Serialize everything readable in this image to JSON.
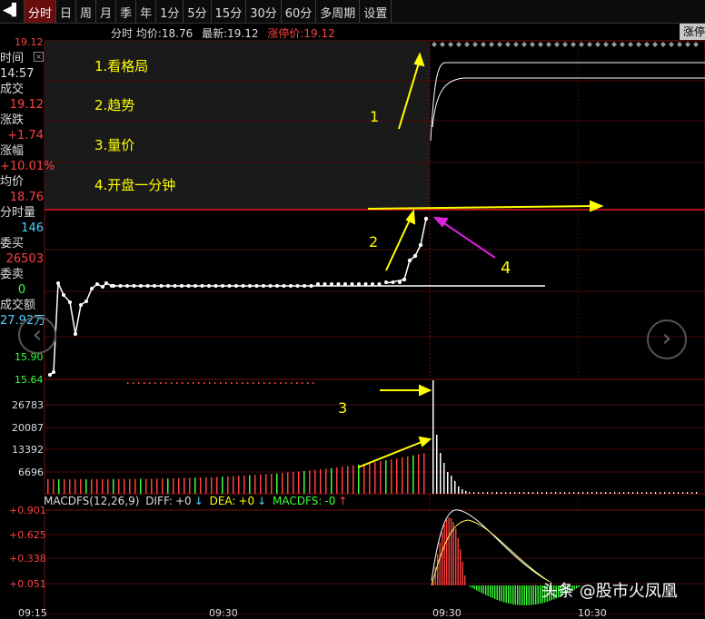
{
  "tabs": [
    "分时",
    "日",
    "周",
    "月",
    "季",
    "年",
    "1分",
    "5分",
    "15分",
    "30分",
    "60分",
    "多周期",
    "设置"
  ],
  "info": {
    "title": "分时",
    "avg_label": "均价:",
    "avg": "18.76",
    "latest_label": "最新:",
    "latest": "19.12",
    "limit_label": "涨停价:",
    "limit": "19.12",
    "limit_button": "涨停"
  },
  "side": {
    "time_label": "时间",
    "time": "14:57",
    "deal_label": "成交",
    "deal": "19.12",
    "change_label": "涨跌",
    "change": "+1.74",
    "pct_label": "涨幅",
    "pct": "+10.01%",
    "avgp_label": "均价",
    "avgp": "18.76",
    "vol_label": "分时量",
    "vol": "146",
    "bid_label": "委买",
    "bid": "26503",
    "ask_label": "委卖",
    "ask": "0",
    "amount_label": "成交额",
    "amount": "27.92万"
  },
  "price_axis": [
    "19.12",
    "15.90",
    "15.64"
  ],
  "volume_axis": [
    "26783",
    "20087",
    "13392",
    "6696"
  ],
  "macd_axis": [
    "+0.901",
    "+0.625",
    "+0.338",
    "+0.051"
  ],
  "time_axis": [
    "09:15",
    "09:30",
    "09:30",
    "10:30"
  ],
  "macd": {
    "name": "MACDFS(12,26,9)",
    "diff_label": "DIFF:",
    "diff": "+0",
    "dea_label": "DEA:",
    "dea": "+0",
    "macdfs_label": "MACDFS:",
    "macdfs": "-0"
  },
  "notes": [
    "1.看格局",
    "2.趋势",
    "3.量价",
    "4.开盘一分钟"
  ],
  "markers": [
    "1",
    "2",
    "3",
    "4"
  ],
  "watermark": "头条 @股市火凤凰",
  "colors": {
    "up": "#ff4040",
    "down": "#3cff3c",
    "grid": "#7a1010",
    "accent": "#ffff00",
    "magenta": "#e020e0"
  }
}
